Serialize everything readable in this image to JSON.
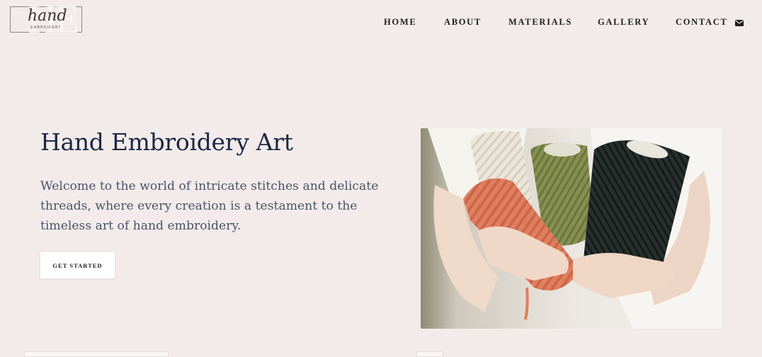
{
  "logo": {
    "monogram": "HE",
    "script": "hand",
    "sub": "EMBROIDERY"
  },
  "nav": {
    "items": [
      "HOME",
      "ABOUT",
      "MATERIALS",
      "GALLERY",
      "CONTACT"
    ],
    "contact_icon": "envelope-icon"
  },
  "hero": {
    "title": "Hand Embroidery Art",
    "description": "Welcome to the world of intricate stitches and delicate threads, where every creation is a testament to the timeless art of hand embroidery.",
    "cta_label": "GET STARTED",
    "image_subject": "hands-holding-yarn-spools"
  },
  "colors": {
    "background": "#f2ebea",
    "title": "#1c2844",
    "body_text": "#4c5267",
    "button_bg": "#ffffff",
    "yarn_orange": "#e07e5e",
    "yarn_green": "#7f8a52",
    "yarn_black": "#1e2522",
    "yarn_cream": "#e8e1d4"
  }
}
